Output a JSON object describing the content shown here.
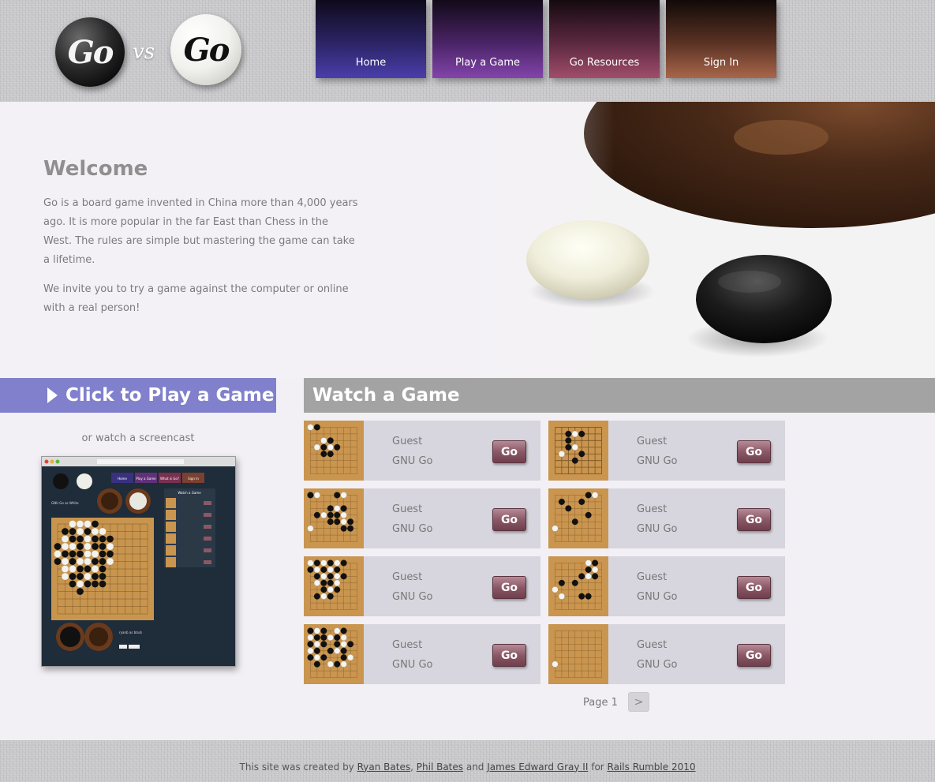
{
  "header": {
    "logo": {
      "left_text": "Go",
      "vs_text": "vs",
      "right_text": "Go"
    },
    "nav": [
      {
        "label": "Home"
      },
      {
        "label": "Play a Game"
      },
      {
        "label": "Go Resources"
      },
      {
        "label": "Sign In"
      }
    ]
  },
  "hero": {
    "title": "Welcome",
    "paragraph1": "Go is a board game invented in China more than 4,000 years ago. It is more popular in the far East than Chess in the West. The rules are simple but mastering the game can take a lifetime.",
    "paragraph2": "We invite you to try a game against the computer or online with a real person!"
  },
  "play": {
    "banner_label": "Click to Play a Game",
    "screencast_text": "or watch a screencast",
    "screencast_preview": {
      "nav": [
        "Home",
        "Play a Game",
        "What is Go?",
        "Sign In"
      ],
      "watch_title": "Watch a Game",
      "top_player": "GNU Go as White",
      "bottom_player": "ryanb as black"
    }
  },
  "watch": {
    "title": "Watch a Game",
    "games": [
      {
        "player1": "Guest",
        "player2": "GNU Go",
        "button": "Go"
      },
      {
        "player1": "Guest",
        "player2": "GNU Go",
        "button": "Go"
      },
      {
        "player1": "Guest",
        "player2": "GNU Go",
        "button": "Go"
      },
      {
        "player1": "Guest",
        "player2": "GNU Go",
        "button": "Go"
      },
      {
        "player1": "Guest",
        "player2": "GNU Go",
        "button": "Go"
      },
      {
        "player1": "Guest",
        "player2": "GNU Go",
        "button": "Go"
      },
      {
        "player1": "Guest",
        "player2": "GNU Go",
        "button": "Go"
      },
      {
        "player1": "Guest",
        "player2": "GNU Go",
        "button": "Go"
      }
    ],
    "pager": {
      "label": "Page 1",
      "next": ">"
    }
  },
  "footer": {
    "prefix": "This site was created by",
    "author1": "Ryan Bates",
    "sep1": ",",
    "author2": "Phil Bates",
    "and_text": "and",
    "author3": "James Edward Gray II",
    "for_text": "for",
    "event": "Rails Rumble 2010"
  },
  "colors": {
    "play_banner": "#8080cc",
    "watch_header": "#a3a3a3",
    "card_bg": "#d7d6de",
    "go_button": "#8b5866"
  }
}
